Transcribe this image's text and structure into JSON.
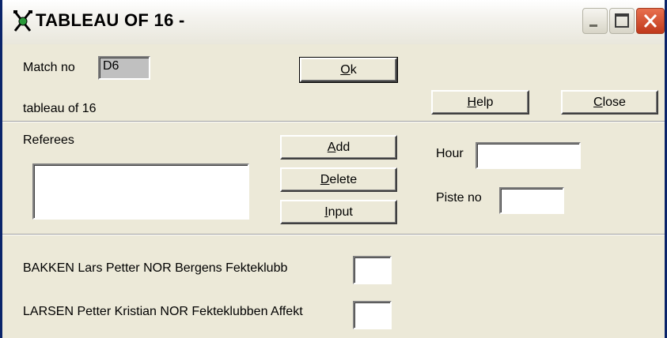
{
  "window": {
    "title": "TABLEAU OF 16 -",
    "icon": "fencing-swords-icon",
    "controls": [
      "minimize-icon",
      "maximize-icon",
      "close-icon"
    ],
    "close_color": "#d7492a"
  },
  "match": {
    "label": "Match no",
    "value": "D6",
    "round_text": "tableau of 16"
  },
  "buttons": {
    "ok": {
      "hotkey": "O",
      "rest": "k"
    },
    "help": {
      "hotkey": "H",
      "rest": "elp"
    },
    "close": {
      "hotkey": "C",
      "rest": "lose"
    },
    "add": {
      "hotkey": "A",
      "rest": "dd"
    },
    "delete": {
      "hotkey": "D",
      "rest": "elete"
    },
    "input": {
      "hotkey": "I",
      "rest": "nput"
    }
  },
  "referees": {
    "label": "Referees",
    "items": []
  },
  "schedule": {
    "hour_label": "Hour",
    "hour_value": "",
    "piste_label": "Piste no",
    "piste_value": ""
  },
  "fencers": [
    {
      "name": "BAKKEN Lars Petter NOR Bergens Fekteklubb",
      "score": ""
    },
    {
      "name": "LARSEN Petter Kristian NOR Fekteklubben Affekt",
      "score": ""
    }
  ]
}
